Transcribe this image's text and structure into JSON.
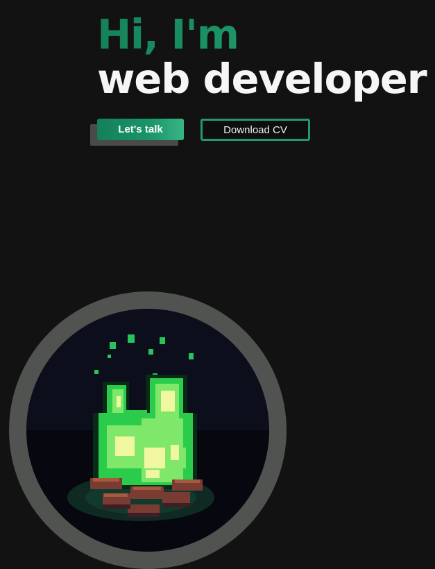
{
  "hero": {
    "greeting": "Hi, I'm",
    "role": "web developer"
  },
  "actions": {
    "primary_label": "Let's talk",
    "secondary_label": "Download CV"
  },
  "colors": {
    "background": "#121212",
    "accent": "#1a9468",
    "accent_light": "#38b585",
    "text": "#f6f6f6",
    "ring": "#505350"
  },
  "avatar": {
    "icon": "pixel-campfire-icon"
  }
}
